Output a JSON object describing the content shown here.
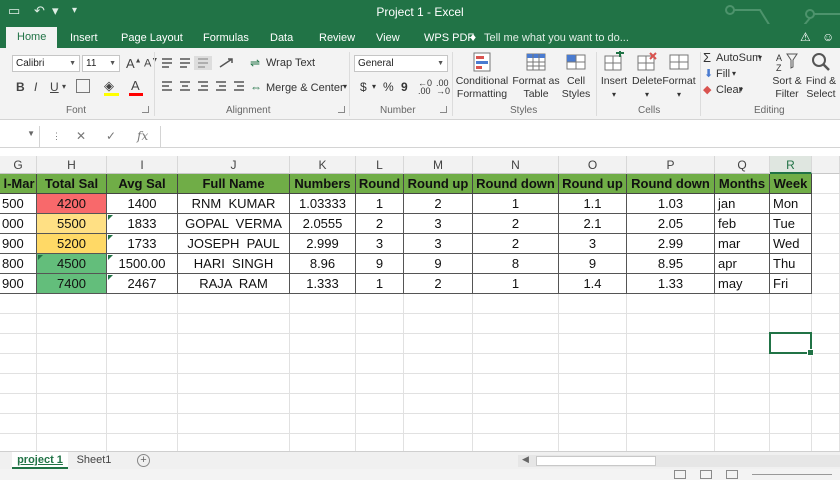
{
  "titlebar": {
    "title": "Project 1 - Excel",
    "save_icon": "save-icon",
    "undo_icon": "undo-icon",
    "redo_icon": "redo-icon"
  },
  "tabs": [
    {
      "label": "Home",
      "active": true
    },
    {
      "label": "Insert"
    },
    {
      "label": "Page Layout"
    },
    {
      "label": "Formulas"
    },
    {
      "label": "Data"
    },
    {
      "label": "Review"
    },
    {
      "label": "View"
    },
    {
      "label": "WPS PDF"
    }
  ],
  "tell_me": "Tell me what you want to do...",
  "ribbon": {
    "font_name": "Calibri",
    "font_size": "11",
    "bold": "B",
    "italic": "I",
    "underline": "U",
    "wrap_text": "Wrap Text",
    "merge_center": "Merge & Center",
    "number_format": "General",
    "currency": "$",
    "percent": "%",
    "comma": "9",
    "conditional_formatting": [
      "Conditional",
      "Formatting"
    ],
    "format_as_table": [
      "Format as",
      "Table"
    ],
    "cell_styles": [
      "Cell",
      "Styles"
    ],
    "insert": "Insert",
    "delete": "Delete",
    "format": "Format",
    "autosum": "AutoSum",
    "fill": "Fill",
    "clear": "Clear",
    "sort_filter": [
      "Sort &",
      "Filter"
    ],
    "find_select": [
      "Find &",
      "Select"
    ],
    "groups": {
      "font": "Font",
      "alignment": "Alignment",
      "number": "Number",
      "styles": "Styles",
      "cells": "Cells",
      "editing": "Editing"
    }
  },
  "formula_bar": {
    "fx": "fx",
    "cancel": "✕",
    "enter": "✓"
  },
  "columns": [
    {
      "letter": "G"
    },
    {
      "letter": "H"
    },
    {
      "letter": "I"
    },
    {
      "letter": "J"
    },
    {
      "letter": "K"
    },
    {
      "letter": "L"
    },
    {
      "letter": "M"
    },
    {
      "letter": "N"
    },
    {
      "letter": "O"
    },
    {
      "letter": "P"
    },
    {
      "letter": "Q"
    },
    {
      "letter": "R",
      "selected": true
    }
  ],
  "table": {
    "headers": [
      "l-Mar",
      "Total Sal",
      "Avg Sal",
      "Full Name",
      "Numbers",
      "Round",
      "Round up",
      "Round down",
      "Round up",
      "Round down",
      "Months",
      "Week"
    ],
    "rows": [
      [
        "500",
        "4200",
        "1400",
        "RNM  KUMAR",
        "1.03333",
        "1",
        "2",
        "1",
        "1.1",
        "1.03",
        "jan",
        "Mon"
      ],
      [
        "000",
        "5500",
        "1833",
        "GOPAL  VERMA",
        "2.0555",
        "2",
        "3",
        "2",
        "2.1",
        "2.05",
        "feb",
        "Tue"
      ],
      [
        "900",
        "5200",
        "1733",
        "JOSEPH  PAUL",
        "2.999",
        "3",
        "3",
        "2",
        "3",
        "2.99",
        "mar",
        "Wed"
      ],
      [
        "800",
        "4500",
        "1500.00",
        "HARI  SINGH",
        "8.96",
        "9",
        "9",
        "8",
        "9",
        "8.95",
        "apr",
        "Thu"
      ],
      [
        "900",
        "7400",
        "2467",
        "RAJA  RAM",
        "1.333",
        "1",
        "2",
        "1",
        "1.4",
        "1.33",
        "may",
        "Fri"
      ]
    ],
    "total_sal_colors": [
      "#f8696b",
      "#ffe084",
      "#ffd966",
      "#63be7b",
      "#63be7b"
    ],
    "header_color": "#70ad47"
  },
  "sheets": [
    {
      "name": "project 1",
      "active": true
    },
    {
      "name": "Sheet1"
    }
  ],
  "add_sheet": "+",
  "colors": {
    "accent": "#217346"
  }
}
